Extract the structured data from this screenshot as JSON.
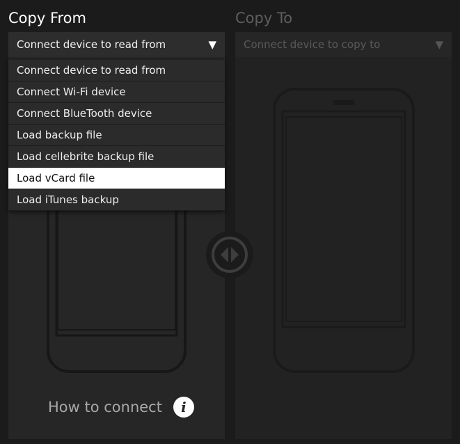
{
  "from": {
    "title": "Copy From",
    "selected_source": "Connect device to read from",
    "how_to_connect": "How to connect",
    "dropdown_options": [
      "Connect device to read from",
      "Connect Wi-Fi device",
      "Connect BlueTooth device",
      "Load backup file",
      "Load cellebrite backup file",
      "Load vCard file",
      "Load iTunes backup"
    ],
    "highlighted_option": "Load vCard file"
  },
  "to": {
    "title": "Copy To",
    "selected_target": "Connect device to copy to"
  },
  "icons": {
    "dropdown_caret": "triangle-down-icon",
    "swap": "swap-arrows-icon",
    "info": "info-icon",
    "phone": "phone-outline-icon"
  },
  "colors": {
    "background": "#1b1b1b",
    "panel": "#262626",
    "selected_option_bg": "#ffffff"
  }
}
